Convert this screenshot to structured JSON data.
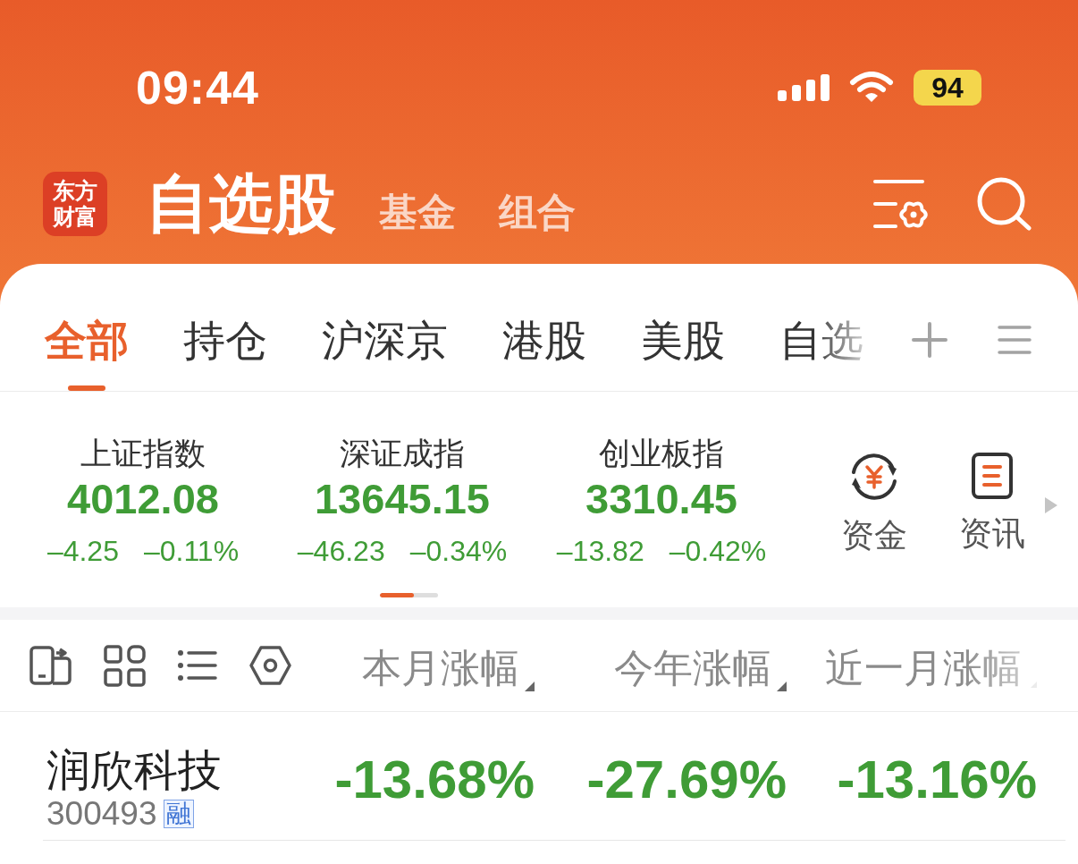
{
  "status_bar": {
    "time": "09:44",
    "battery": "94"
  },
  "header": {
    "logo": [
      "东方",
      "财富"
    ],
    "tabs": [
      {
        "label": "自选股",
        "selected": true
      },
      {
        "label": "基金",
        "selected": false
      },
      {
        "label": "组合",
        "selected": false
      }
    ]
  },
  "tabs": [
    {
      "label": "全部",
      "selected": true
    },
    {
      "label": "持仓",
      "selected": false
    },
    {
      "label": "沪深京",
      "selected": false
    },
    {
      "label": "港股",
      "selected": false
    },
    {
      "label": "美股",
      "selected": false
    },
    {
      "label": "自选",
      "selected": false
    }
  ],
  "indices": [
    {
      "name": "上证指数",
      "value": "4012.08",
      "change": "–4.25",
      "percent": "–0.11%"
    },
    {
      "name": "深证成指",
      "value": "13645.15",
      "change": "–46.23",
      "percent": "–0.34%"
    },
    {
      "name": "创业板指",
      "value": "3310.45",
      "change": "–13.82",
      "percent": "–0.42%"
    }
  ],
  "shortcuts": [
    {
      "kind": "funds",
      "label": "资金"
    },
    {
      "kind": "news",
      "label": "资讯"
    }
  ],
  "table": {
    "columns": [
      "本月涨幅",
      "今年涨幅",
      "近一月涨幅"
    ],
    "rows": [
      {
        "name": "润欣科技",
        "code": "300493",
        "tag": "融",
        "values": [
          "-13.68%",
          "-27.69%",
          "-13.16%"
        ]
      }
    ]
  }
}
